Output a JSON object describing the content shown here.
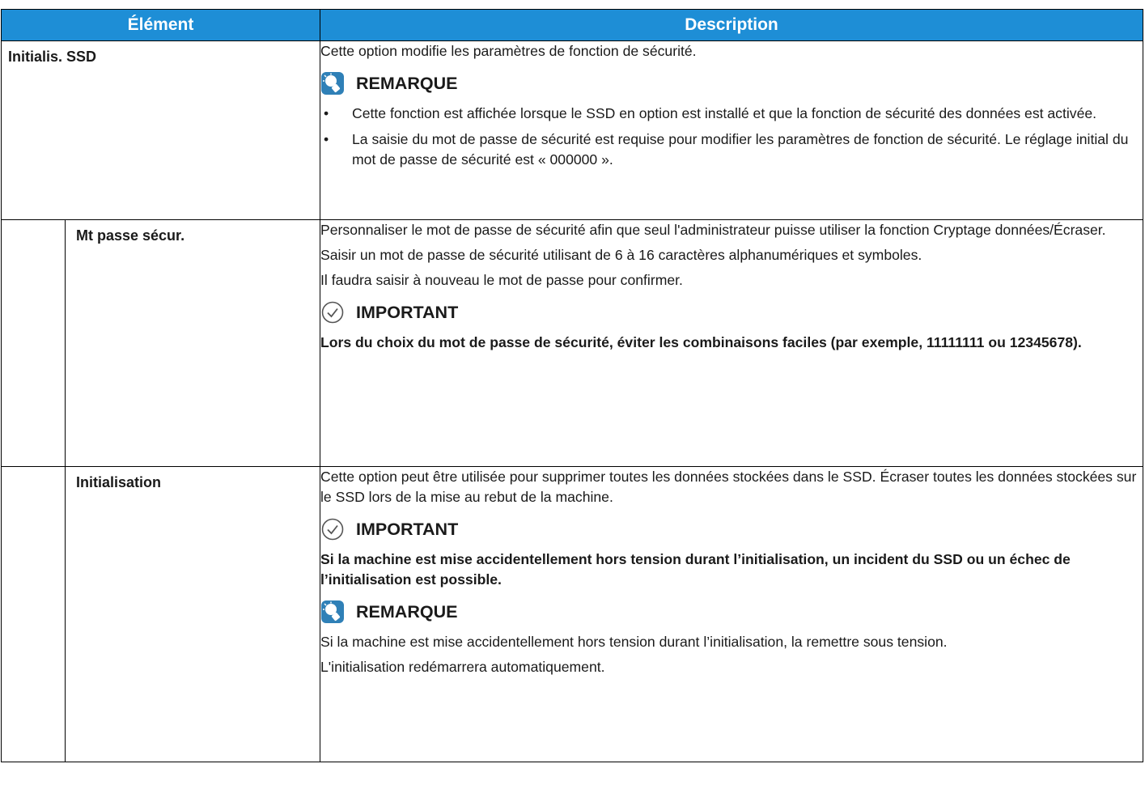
{
  "header": {
    "col_item": "Élément",
    "col_desc": "Description"
  },
  "rows": {
    "ssd": {
      "label": "Initialis. SSD",
      "intro": "Cette option modifie les paramètres de fonction de sécurité.",
      "note_title": "REMARQUE",
      "bullets": [
        "Cette fonction est affichée lorsque le SSD en option est installé et que la fonction de sécurité des données est activée.",
        "La saisie du mot de passe de sécurité est requise pour modifier les paramètres de fonction de sécurité. Le réglage initial du mot de passe de sécurité est « 000000 »."
      ]
    },
    "password": {
      "label": "Mt passe sécur.",
      "p1": "Personnaliser le mot de passe de sécurité afin que seul l'administrateur puisse utiliser la fonction Cryptage données/Écraser.",
      "p2": "Saisir un mot de passe de sécurité utilisant de 6 à 16 caractères alphanumériques et symboles.",
      "p3": "Il faudra saisir à nouveau le mot de passe pour confirmer.",
      "important_title": "IMPORTANT",
      "important_text": "Lors du choix du mot de passe de sécurité, éviter les combinaisons faciles (par exemple, 11111111 ou 12345678)."
    },
    "init": {
      "label": "Initialisation",
      "p1": "Cette option peut être utilisée pour supprimer toutes les données stockées dans le SSD. Écraser toutes les données stockées sur le SSD lors de la mise au rebut de la machine.",
      "important_title": "IMPORTANT",
      "important_text": "Si la machine est mise accidentellement hors tension durant l’initialisation, un incident du SSD ou un échec de l’initialisation est possible.",
      "note_title": "REMARQUE",
      "note_p1": "Si la machine est mise accidentellement hors tension durant l’initialisation, la remettre sous tension.",
      "note_p2": "L'initialisation redémarrera automatiquement."
    }
  },
  "bullet_char": "•",
  "icons": {
    "note": "lightbulb-note-icon",
    "important": "checkmark-circle-icon"
  },
  "colors": {
    "header_bg": "#1e8ed6",
    "header_text": "#ffffff",
    "note_icon": "#2f80b7"
  }
}
